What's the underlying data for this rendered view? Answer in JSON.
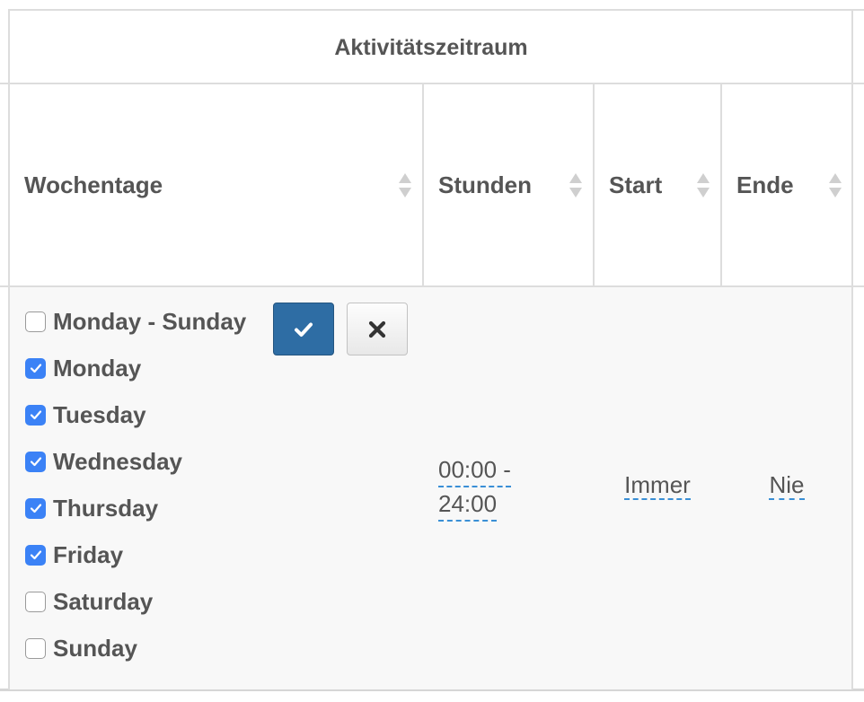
{
  "section_title": "Aktivitätszeitraum",
  "columns": {
    "weekdays": "Wochentage",
    "hours": "Stunden",
    "start": "Start",
    "end": "Ende"
  },
  "weekdays_editor": {
    "all_label": "Monday - Sunday",
    "all_checked": false,
    "days": [
      {
        "label": "Monday",
        "checked": true
      },
      {
        "label": "Tuesday",
        "checked": true
      },
      {
        "label": "Wednesday",
        "checked": true
      },
      {
        "label": "Thursday",
        "checked": true
      },
      {
        "label": "Friday",
        "checked": true
      },
      {
        "label": "Saturday",
        "checked": false
      },
      {
        "label": "Sunday",
        "checked": false
      }
    ],
    "confirm_icon": "check-icon",
    "cancel_icon": "close-icon"
  },
  "row": {
    "hours_from": "00:00 -",
    "hours_to": "24:00",
    "start": "Immer",
    "end": "Nie"
  },
  "colors": {
    "checkbox_checked": "#3b82f6",
    "confirm_button": "#2e6da4",
    "editable_underline": "#3a8fd6"
  }
}
